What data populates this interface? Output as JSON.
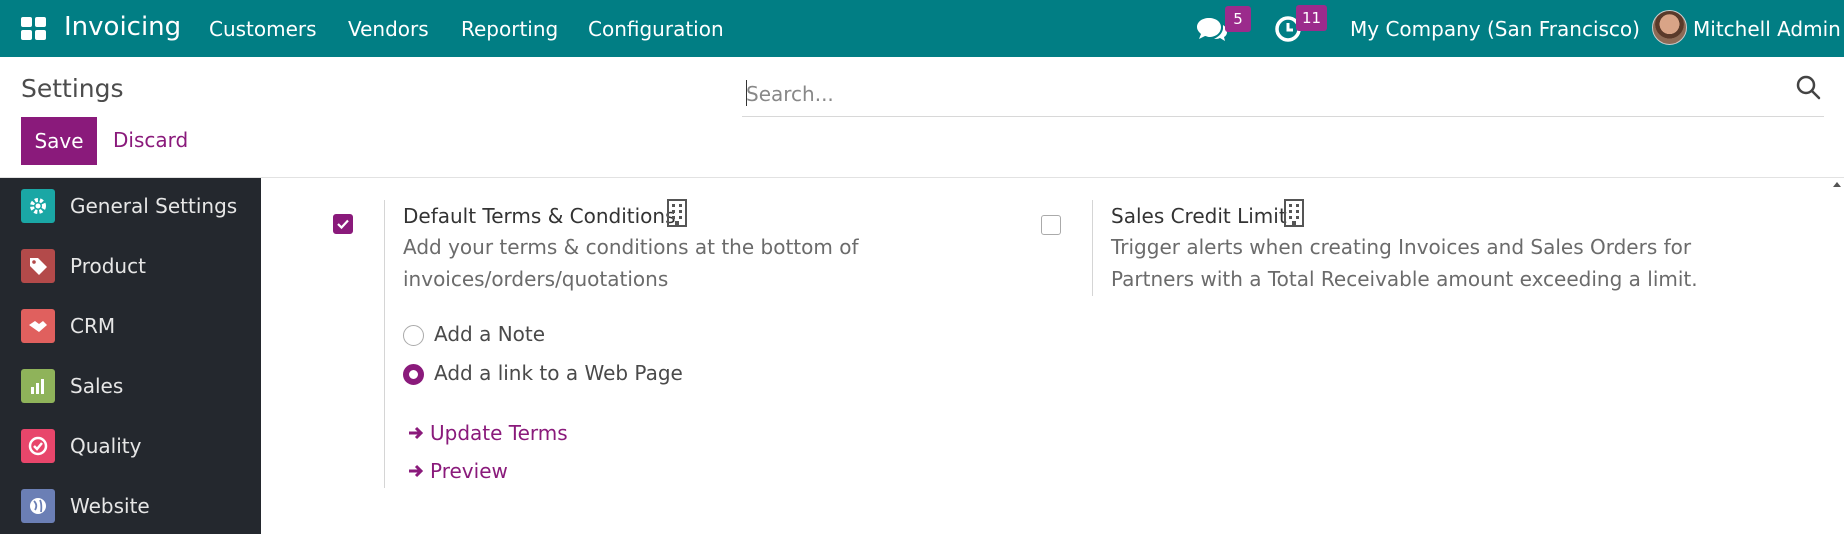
{
  "navbar": {
    "app_name": "Invoicing",
    "menu": [
      "Customers",
      "Vendors",
      "Reporting",
      "Configuration"
    ],
    "messages_count": "5",
    "activities_count": "11",
    "company": "My Company (San Francisco)",
    "user": "Mitchell Admin",
    "color": "#017e84"
  },
  "control_panel": {
    "title": "Settings",
    "search_placeholder": "Search...",
    "save_label": "Save",
    "discard_label": "Discard"
  },
  "sidebar": {
    "items": [
      {
        "label": "General Settings",
        "icon": "gear-icon",
        "color": "#1aa7a5"
      },
      {
        "label": "Product",
        "icon": "tags-icon",
        "color": "#b34a4a"
      },
      {
        "label": "CRM",
        "icon": "handshake-icon",
        "color": "#e0605e"
      },
      {
        "label": "Sales",
        "icon": "chart-icon",
        "color": "#8fb35a"
      },
      {
        "label": "Quality",
        "icon": "badge-check-icon",
        "color": "#e8466b"
      },
      {
        "label": "Website",
        "icon": "globe-icon",
        "color": "#6b7fb5"
      }
    ]
  },
  "settings": {
    "terms": {
      "title": "Default Terms & Conditions",
      "checked": true,
      "desc_line1": "Add your terms & conditions at the bottom of",
      "desc_line2": "invoices/orders/quotations",
      "options": [
        {
          "label": "Add a Note",
          "selected": false
        },
        {
          "label": "Add a link to a Web Page",
          "selected": true
        }
      ],
      "links": [
        "Update Terms",
        "Preview"
      ]
    },
    "credit": {
      "title": "Sales Credit Limit",
      "checked": false,
      "desc_line1": "Trigger alerts when creating Invoices and Sales Orders for",
      "desc_line2": "Partners with a Total Receivable amount exceeding a limit."
    }
  },
  "accent_color": "#8a1a7b"
}
